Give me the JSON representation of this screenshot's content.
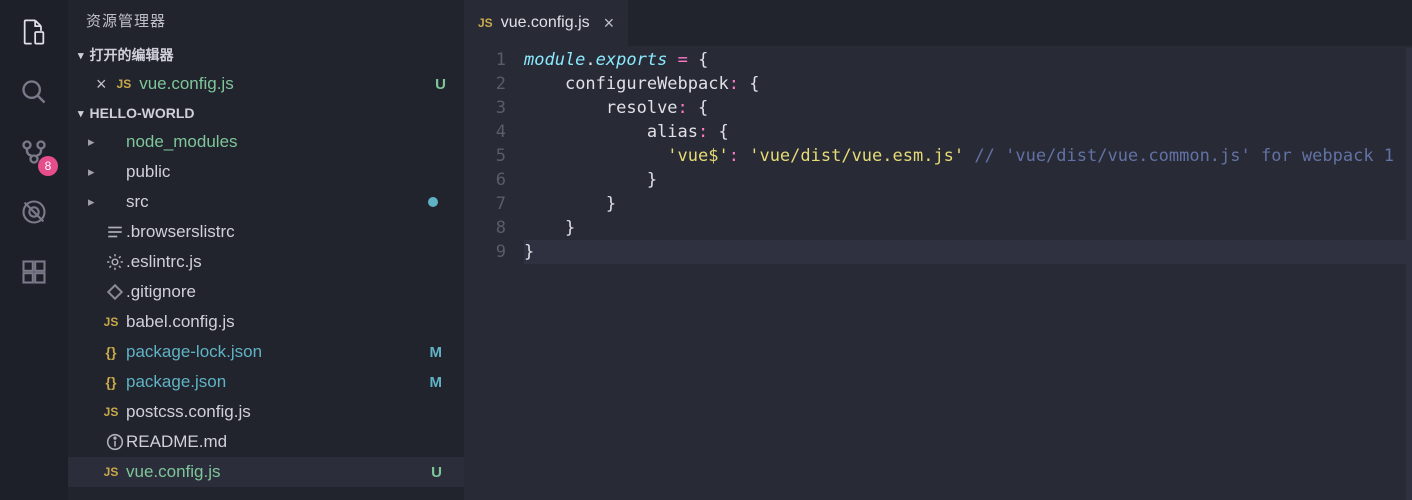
{
  "activityBar": {
    "badge": "8"
  },
  "sidebar": {
    "title": "资源管理器",
    "openEditors": {
      "header": "打开的编辑器",
      "items": [
        {
          "badge": "JS",
          "name": "vue.config.js",
          "status": "U"
        }
      ]
    },
    "project": {
      "header": "HELLO-WORLD",
      "items": [
        {
          "type": "folder",
          "name": "node_modules",
          "color": "green"
        },
        {
          "type": "folder",
          "name": "public"
        },
        {
          "type": "folder",
          "name": "src",
          "modified": true
        },
        {
          "type": "file",
          "icon": "lines",
          "name": ".browserslistrc"
        },
        {
          "type": "file",
          "icon": "gear",
          "name": ".eslintrc.js"
        },
        {
          "type": "file",
          "icon": "diamond",
          "name": ".gitignore"
        },
        {
          "type": "file",
          "icon": "js",
          "name": "babel.config.js"
        },
        {
          "type": "file",
          "icon": "json",
          "name": "package-lock.json",
          "color": "blue",
          "status": "M"
        },
        {
          "type": "file",
          "icon": "json",
          "name": "package.json",
          "color": "blue",
          "status": "M"
        },
        {
          "type": "file",
          "icon": "js",
          "name": "postcss.config.js"
        },
        {
          "type": "file",
          "icon": "info",
          "name": "README.md"
        },
        {
          "type": "file",
          "icon": "js",
          "name": "vue.config.js",
          "color": "green",
          "status": "U",
          "selected": true
        }
      ]
    }
  },
  "tabs": [
    {
      "badge": "JS",
      "name": "vue.config.js"
    }
  ],
  "code": {
    "lines": [
      {
        "n": "1",
        "html": "<span class='tok-keyword'>module</span><span class='tok-punct'>.</span><span class='tok-keyword'>exports</span> <span class='tok-op'>=</span> <span class='tok-punct'>{</span>"
      },
      {
        "n": "2",
        "html": "    <span class='tok-prop'>configureWebpack</span><span class='tok-op'>:</span> <span class='tok-punct'>{</span>"
      },
      {
        "n": "3",
        "html": "        <span class='tok-prop'>resolve</span><span class='tok-op'>:</span> <span class='tok-punct'>{</span>"
      },
      {
        "n": "4",
        "html": "            <span class='tok-prop'>alias</span><span class='tok-op'>:</span> <span class='tok-punct'>{</span>"
      },
      {
        "n": "5",
        "html": "              <span class='tok-string'>'vue$'</span><span class='tok-op'>:</span> <span class='tok-string'>'vue/dist/vue.esm.js'</span> <span class='tok-comment'>// 'vue/dist/vue.common.js' for webpack 1</span>"
      },
      {
        "n": "6",
        "html": "            <span class='tok-punct'>}</span>"
      },
      {
        "n": "7",
        "html": "        <span class='tok-punct'>}</span>"
      },
      {
        "n": "8",
        "html": "    <span class='tok-punct'>}</span>"
      },
      {
        "n": "9",
        "html": "<span class='tok-punct'>}</span>",
        "current": true
      }
    ]
  }
}
